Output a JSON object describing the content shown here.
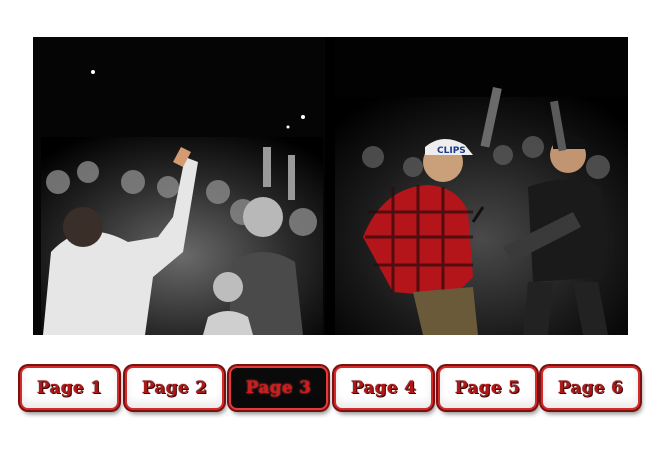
{
  "photo": {
    "description_icon": "concert-crowd-photo",
    "cap_text": "CLIPS"
  },
  "pager": {
    "current": 3,
    "pages": [
      {
        "label": "Page 1"
      },
      {
        "label": "Page 2"
      },
      {
        "label": "Page 3"
      },
      {
        "label": "Page 4"
      },
      {
        "label": "Page 5"
      },
      {
        "label": "Page 6"
      }
    ]
  },
  "colors": {
    "accent": "#d32a2a",
    "text": "#b01717",
    "active_bg": "#0a0a0a"
  }
}
